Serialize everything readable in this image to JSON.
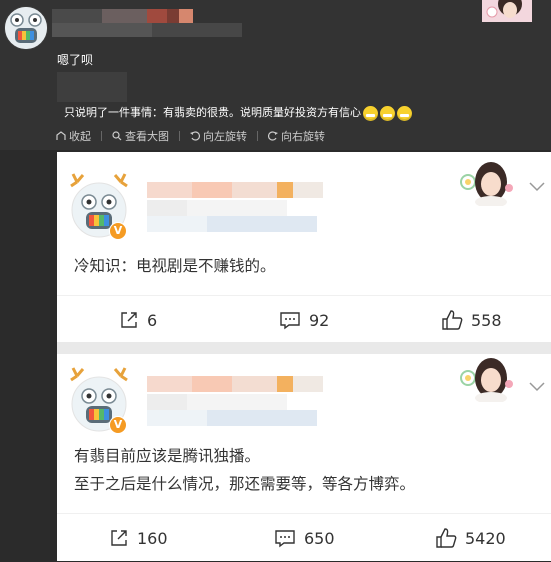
{
  "header": {
    "reply_text": "嗯了呗",
    "quote_text": "只说明了一件事情：有翡卖的很贵。说明质量好投资方有信心",
    "actions": [
      {
        "label": "收起",
        "icon": "collapse-icon"
      },
      {
        "label": "查看大图",
        "icon": "search-icon"
      },
      {
        "label": "向左旋转",
        "icon": "rotate-left-icon"
      },
      {
        "label": "向右旋转",
        "icon": "rotate-right-icon"
      }
    ]
  },
  "posts": [
    {
      "badge": "V",
      "text_lines": [
        "冷知识：电视剧是不赚钱的。"
      ],
      "share_count": "6",
      "comment_count": "92",
      "like_count": "558"
    },
    {
      "badge": "V",
      "text_lines": [
        "有翡目前应该是腾讯独播。",
        "至于之后是什么情况，那还需要等，等各方博弈。"
      ],
      "share_count": "160",
      "comment_count": "650",
      "like_count": "5420"
    }
  ],
  "colors": {
    "dark_bg": "#333333",
    "card_bg": "#ffffff",
    "badge": "#f59b23"
  }
}
